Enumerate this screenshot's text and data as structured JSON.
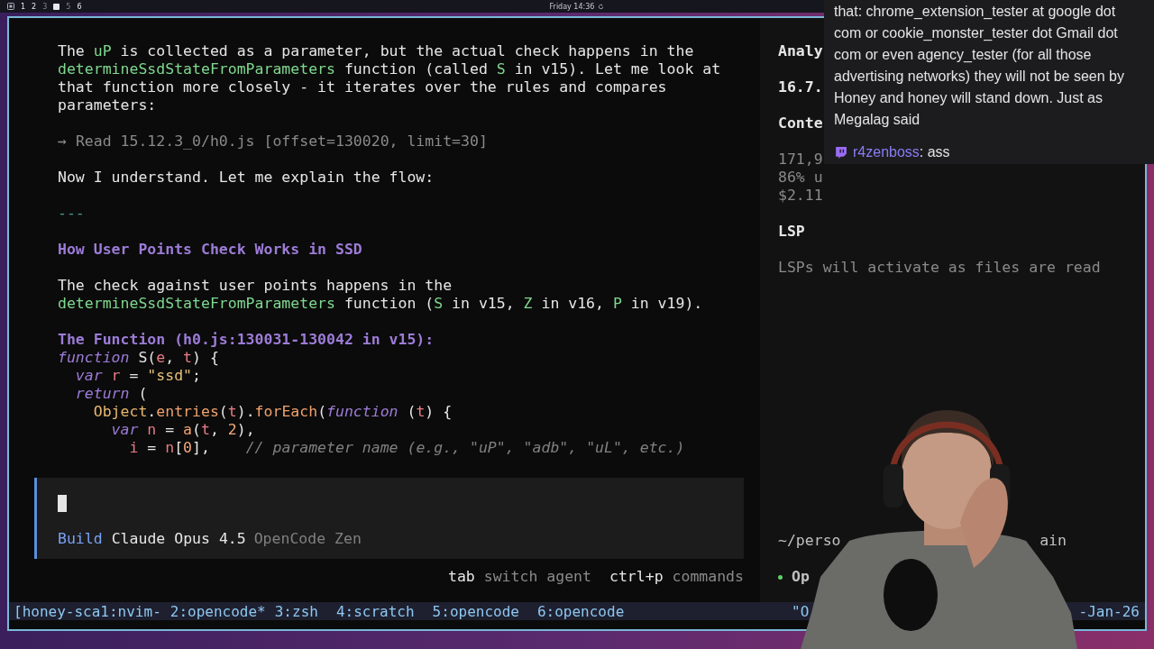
{
  "top_bar": {
    "workspaces": [
      {
        "label": "1",
        "selected": false,
        "occupied": true
      },
      {
        "label": "2",
        "selected": false,
        "occupied": true
      },
      {
        "label": "3",
        "selected": false,
        "occupied": false
      },
      {
        "selected": true
      },
      {
        "label": "5",
        "selected": false,
        "occupied": false
      },
      {
        "label": "6",
        "selected": false,
        "occupied": true
      }
    ],
    "clock": "Friday 14:36"
  },
  "conversation": [
    {
      "kind": "paragraph",
      "lines": [
        [
          {
            "t": "The "
          },
          {
            "t": "uP",
            "kind": "accent"
          },
          {
            "t": " is collected as a parameter, but the actual check happens in the"
          }
        ],
        [
          {
            "t": "determineSsdStateFromParameters",
            "kind": "accent"
          },
          {
            "t": " function (called "
          },
          {
            "t": "S",
            "kind": "accent"
          },
          {
            "t": " in v15). Let me look at"
          }
        ],
        [
          {
            "t": "that function more closely - it iterates over the rules and compares"
          }
        ],
        [
          {
            "t": "parameters:"
          }
        ]
      ]
    },
    {
      "kind": "tool",
      "icon": "→",
      "text": "Read 15.12.3_0/h0.js [offset=130020, limit=30]"
    },
    {
      "kind": "paragraph",
      "lines": [
        [
          {
            "t": "Now I understand. Let me explain the flow:"
          }
        ]
      ]
    },
    {
      "kind": "rule",
      "text": "---"
    },
    {
      "kind": "heading",
      "text": "How User Points Check Works in SSD"
    },
    {
      "kind": "paragraph",
      "lines": [
        [
          {
            "t": "The check against user points happens in the"
          }
        ],
        [
          {
            "t": "determineSsdStateFromParameters",
            "kind": "accent"
          },
          {
            "t": " function ("
          },
          {
            "t": "S",
            "kind": "accent"
          },
          {
            "t": " in v15, "
          },
          {
            "t": "Z",
            "kind": "accent"
          },
          {
            "t": " in v16, "
          },
          {
            "t": "P",
            "kind": "accent"
          },
          {
            "t": " in v19)."
          }
        ]
      ]
    },
    {
      "kind": "code",
      "title": "The Function (h0.js:130031-130042 in v15):",
      "lines": [
        [
          {
            "t": "function",
            "kind": "kw"
          },
          {
            "t": " S("
          },
          {
            "t": "e",
            "kind": "var"
          },
          {
            "t": ", "
          },
          {
            "t": "t",
            "kind": "var"
          },
          {
            "t": ") {"
          }
        ],
        [
          {
            "t": "  var ",
            "kind": "kw"
          },
          {
            "t": "r",
            "kind": "var"
          },
          {
            "t": " = "
          },
          {
            "t": "\"ssd\"",
            "kind": "str"
          },
          {
            "t": ";"
          }
        ],
        [
          {
            "t": "  return",
            "kind": "kw"
          },
          {
            "t": " ("
          }
        ],
        [
          {
            "t": "    Object",
            "kind": "builtin"
          },
          {
            "t": "."
          },
          {
            "t": "entries",
            "kind": "method"
          },
          {
            "t": "("
          },
          {
            "t": "t",
            "kind": "var"
          },
          {
            "t": ")."
          },
          {
            "t": "forEach",
            "kind": "method"
          },
          {
            "t": "("
          },
          {
            "t": "function",
            "kind": "kw"
          },
          {
            "t": " ("
          },
          {
            "t": "t",
            "kind": "var"
          },
          {
            "t": ") {"
          }
        ],
        [
          {
            "t": "      var ",
            "kind": "kw"
          },
          {
            "t": "n",
            "kind": "var"
          },
          {
            "t": " = "
          },
          {
            "t": "a",
            "kind": "method"
          },
          {
            "t": "("
          },
          {
            "t": "t",
            "kind": "var"
          },
          {
            "t": ", "
          },
          {
            "t": "2",
            "kind": "num"
          },
          {
            "t": "),"
          }
        ],
        [
          {
            "t": "        i",
            "kind": "var"
          },
          {
            "t": " = "
          },
          {
            "t": "n",
            "kind": "var"
          },
          {
            "t": "["
          },
          {
            "t": "0",
            "kind": "num"
          },
          {
            "t": "],    "
          },
          {
            "t": "// parameter name (e.g., \"uP\", \"adb\", \"uL\", etc.)",
            "kind": "comment"
          }
        ]
      ]
    }
  ],
  "prompt": {
    "agent": "Build",
    "model": "Claude Opus 4.5",
    "provider": "OpenCode Zen"
  },
  "hints": [
    {
      "key": "tab",
      "action": "switch agent"
    },
    {
      "key": "ctrl+p",
      "action": "commands"
    }
  ],
  "sidebar": {
    "sections": [
      {
        "title": "Analy",
        "lines": [
          {
            "text": "16.7.",
            "kind": "strong"
          }
        ]
      },
      {
        "title": "Conte",
        "lines": [
          {
            "text": "171,9",
            "kind": "muted"
          },
          {
            "text": "86% u",
            "kind": "muted"
          },
          {
            "text": "$2.11",
            "kind": "muted"
          }
        ]
      },
      {
        "title": "LSP",
        "lines": [
          {
            "text": "LSPs will activate as files are read",
            "kind": "muted"
          }
        ]
      }
    ],
    "path": "~/perso",
    "path_tail": "ain",
    "status": "Op"
  },
  "status_bar": {
    "windows": [
      "[honey-sca1:nvim-",
      "2:opencode*",
      "3:zsh",
      "4:scratch",
      "5:opencode",
      "6:opencode"
    ],
    "right": "\"O",
    "date": "-Jan-26"
  },
  "chat": {
    "messages": [
      {
        "kind": "text",
        "lines": [
          "that: chrome_extension_tester at google dot",
          "com or cookie_monster_tester dot Gmail dot",
          "com or even agency_tester (for all those",
          "advertising networks) they will not be seen by",
          "Honey and honey will stand down. Just as",
          "Megalag said"
        ]
      },
      {
        "kind": "user",
        "user": "r4zenboss",
        "text": ": ass"
      }
    ]
  }
}
